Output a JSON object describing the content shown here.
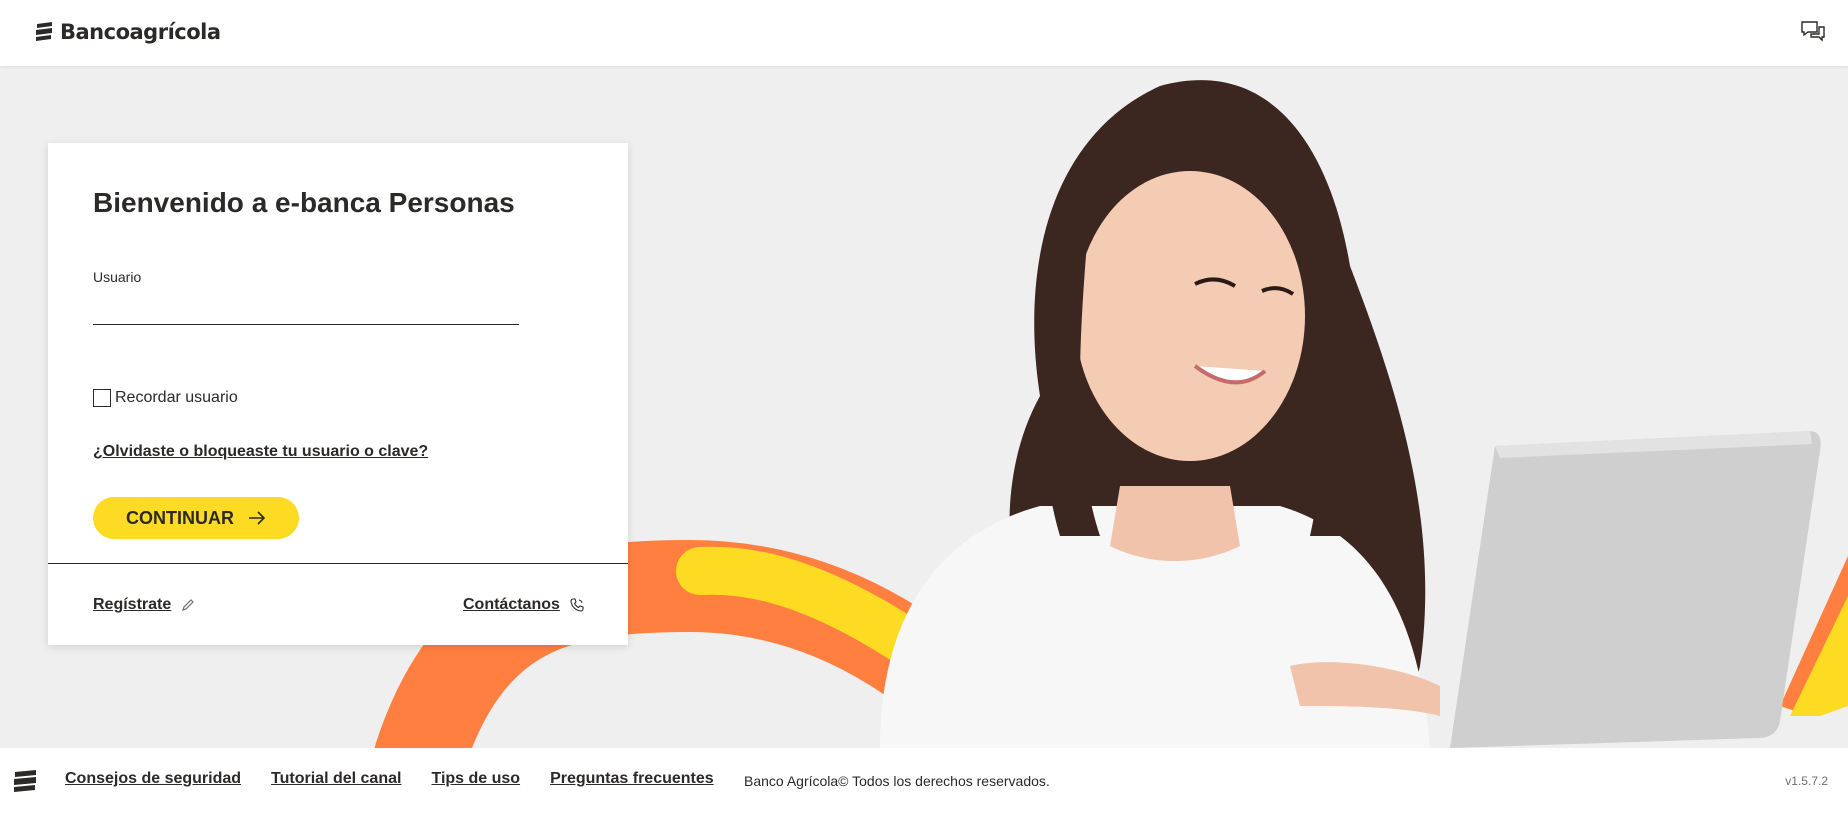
{
  "header": {
    "brand": "Bancoagrícola",
    "chat_icon": "chat-bubbles-icon"
  },
  "login": {
    "title": "Bienvenido a e-banca Personas",
    "user_label": "Usuario",
    "user_value": "",
    "remember_label": "Recordar usuario",
    "remember_checked": false,
    "forgot_link": "¿Olvidaste o bloqueaste tu usuario o clave?",
    "continue_label": "CONTINUAR",
    "register_label": "Regístrate",
    "contact_label": "Contáctanos"
  },
  "footer": {
    "links": [
      "Consejos de seguridad",
      "Tutorial del canal",
      "Tips de uso",
      "Preguntas frecuentes"
    ],
    "copyright": "Banco Agrícola© Todos los derechos reservados.",
    "version": "v1.5.7.2"
  },
  "colors": {
    "brand_yellow": "#fddb23",
    "brand_orange": "#ff7f41",
    "text_dark": "#2c2a29",
    "hero_bg": "#efefef"
  }
}
